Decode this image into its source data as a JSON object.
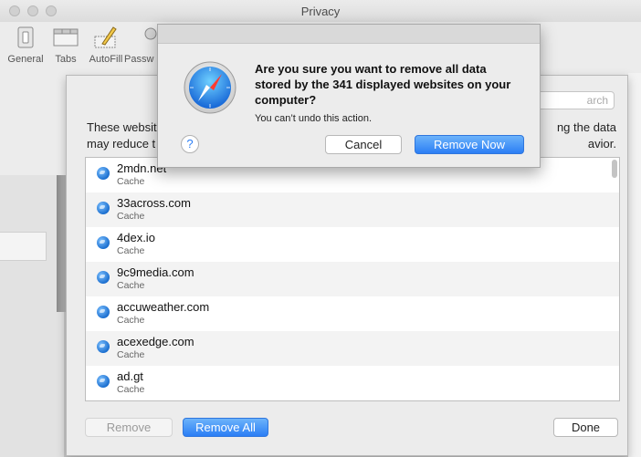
{
  "window": {
    "title": "Privacy"
  },
  "toolbar": {
    "items": [
      {
        "label": "General",
        "icon": "switch-icon"
      },
      {
        "label": "Tabs",
        "icon": "tabs-icon"
      },
      {
        "label": "AutoFill",
        "icon": "pencil-icon"
      },
      {
        "label": "Passw",
        "icon": "key-icon"
      }
    ]
  },
  "sheet": {
    "search_placeholder": "Search",
    "search_visible": "arch",
    "description_left_1": "These websit",
    "description_left_2": "may reduce t",
    "description_right_1": "ng the data",
    "description_right_2": "avior.",
    "sites": [
      {
        "name": "2mdn.net",
        "kind": "Cache"
      },
      {
        "name": "33across.com",
        "kind": "Cache"
      },
      {
        "name": "4dex.io",
        "kind": "Cache"
      },
      {
        "name": "9c9media.com",
        "kind": "Cache"
      },
      {
        "name": "accuweather.com",
        "kind": "Cache"
      },
      {
        "name": "acexedge.com",
        "kind": "Cache"
      },
      {
        "name": "ad.gt",
        "kind": "Cache"
      }
    ],
    "remove_label": "Remove",
    "remove_all_label": "Remove All",
    "done_label": "Done"
  },
  "alert": {
    "title": "Are you sure you want to remove all data stored by the 341 displayed websites on your computer?",
    "subtitle": "You can’t undo this action.",
    "cancel_label": "Cancel",
    "confirm_label": "Remove Now",
    "help_label": "?"
  },
  "colors": {
    "accent": "#2b7ef5",
    "background": "#ececec"
  }
}
